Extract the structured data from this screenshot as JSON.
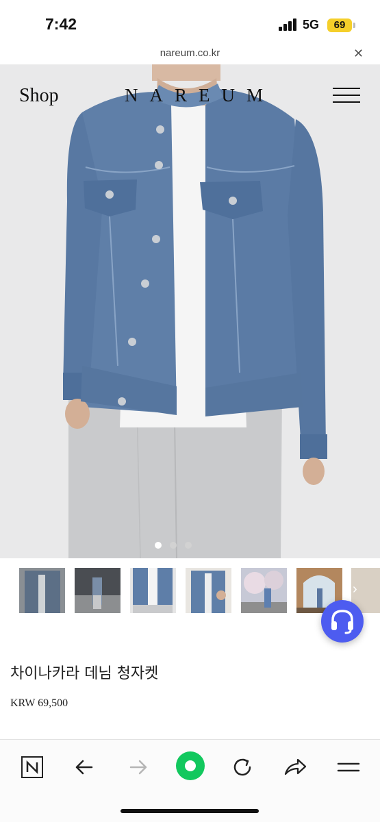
{
  "status_bar": {
    "time": "7:42",
    "network": "5G",
    "battery": "69",
    "battery_color": "#f5cf2a"
  },
  "browser": {
    "url": "nareum.co.kr",
    "close_icon": "close-icon"
  },
  "header": {
    "shop_label": "Shop",
    "brand": "NAREUM",
    "menu_icon": "hamburger-menu-icon"
  },
  "gallery": {
    "slide_count": 3,
    "active_slide": 1,
    "thumbnail_count": 7
  },
  "product": {
    "name": "차이나카라 데님 청자켓",
    "price": "KRW 69,500"
  },
  "chat": {
    "icon": "headset-icon",
    "color": "#4d5cf0"
  },
  "toolbar": {
    "items": [
      "naver-n-icon",
      "back-arrow-icon",
      "forward-arrow-icon",
      "green-dot-icon",
      "reload-icon",
      "share-icon",
      "menu-icon"
    ],
    "accent": "#12c85e"
  }
}
